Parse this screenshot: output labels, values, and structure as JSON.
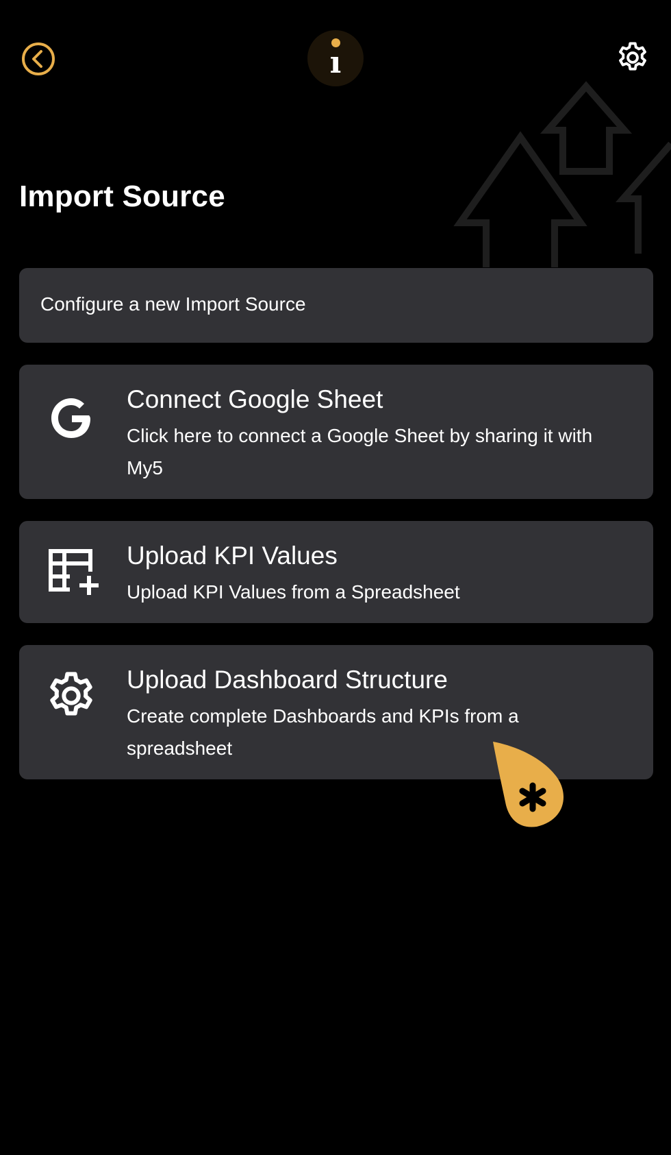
{
  "colors": {
    "accent": "#e8ae4a",
    "card_bg": "#323236",
    "page_bg": "#000000"
  },
  "header": {
    "back_icon": "chevron-left-circle-icon",
    "info_icon": "info-icon",
    "settings_icon": "gear-icon"
  },
  "page": {
    "title": "Import Source"
  },
  "intro": {
    "text": "Configure a new Import Source"
  },
  "options": [
    {
      "icon": "google-icon",
      "title": "Connect Google Sheet",
      "description": "Click here to connect a Google Sheet by sharing it with My5"
    },
    {
      "icon": "table-add-icon",
      "title": "Upload KPI Values",
      "description": "Upload KPI Values from a Spreadsheet"
    },
    {
      "icon": "gear-icon",
      "title": "Upload Dashboard Structure",
      "description": "Create complete Dashboards and KPIs from a spreadsheet"
    }
  ],
  "help": {
    "icon": "asterisk-icon",
    "symbol": "*"
  }
}
